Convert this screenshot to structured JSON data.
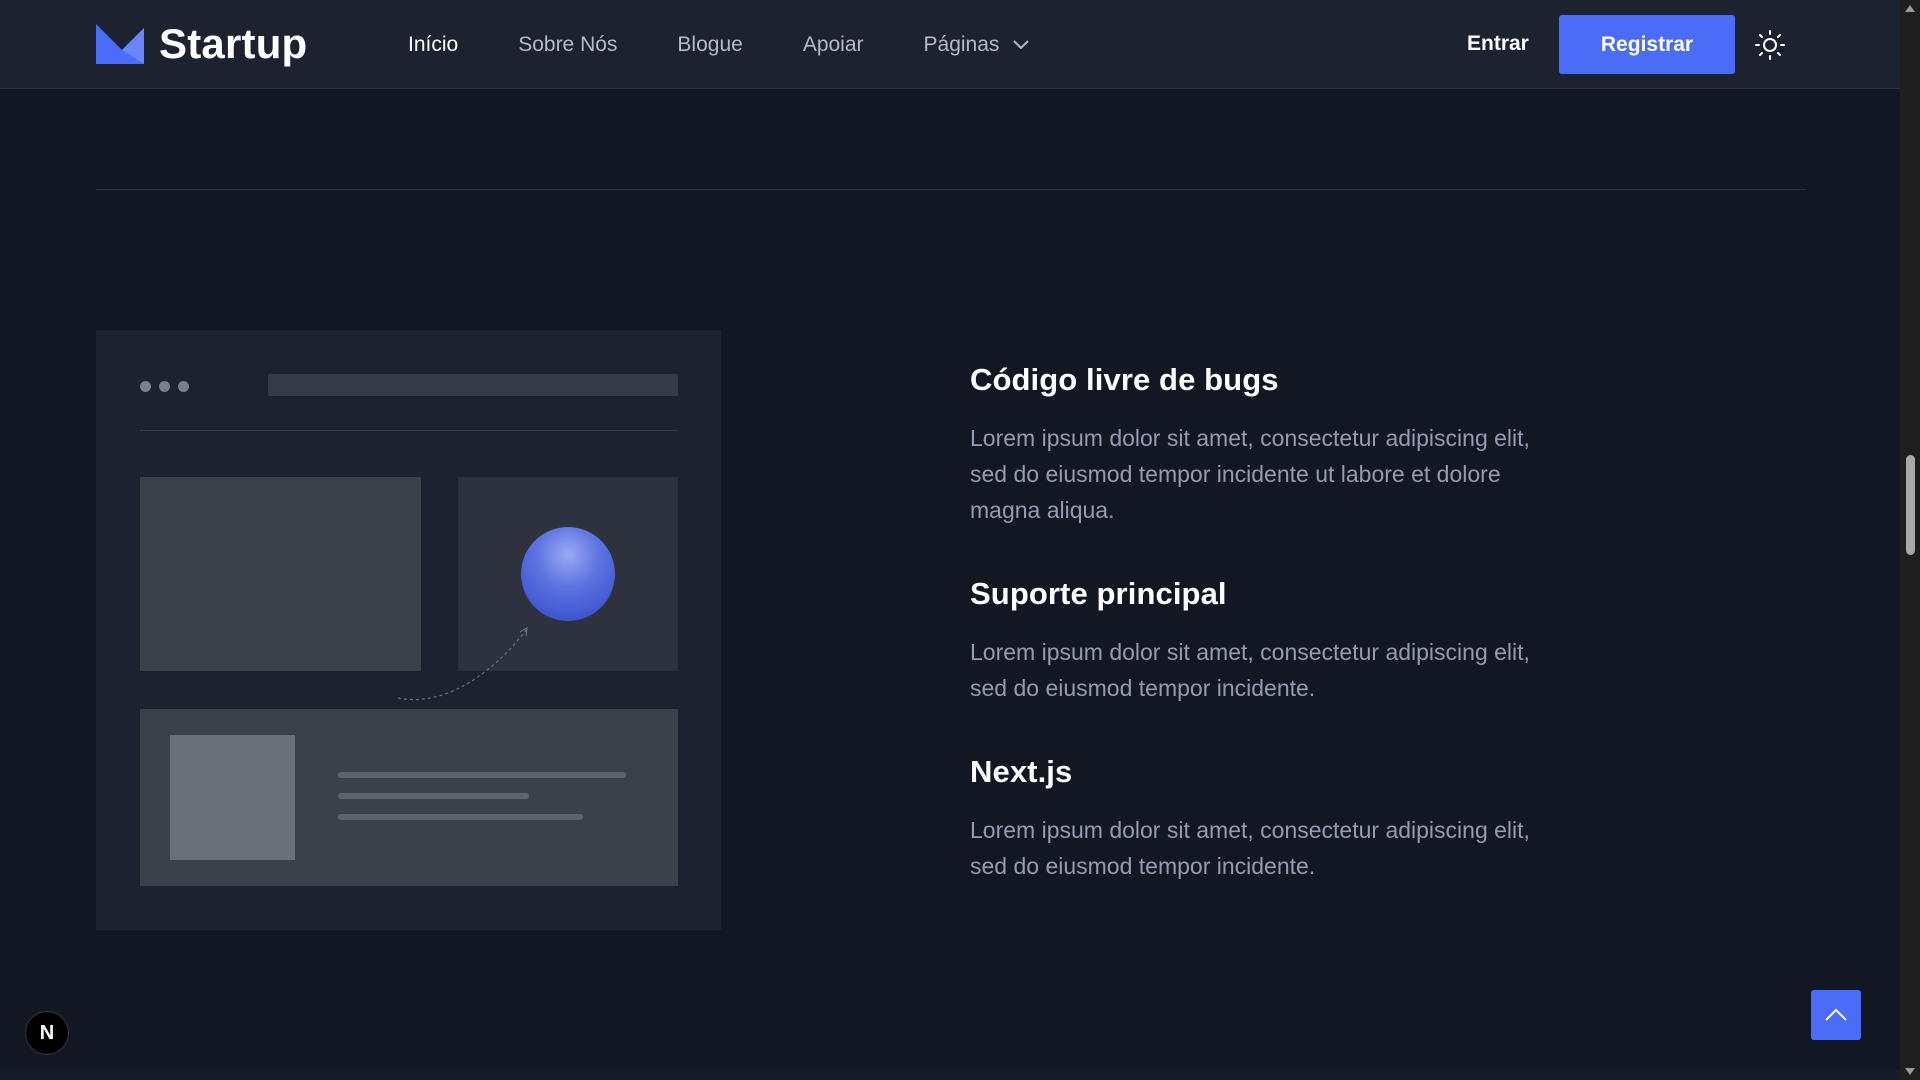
{
  "header": {
    "logo_text": "Startup",
    "nav": [
      {
        "label": "Início",
        "active": true
      },
      {
        "label": "Sobre Nós"
      },
      {
        "label": "Blogue"
      },
      {
        "label": "Apoiar"
      },
      {
        "label": "Páginas",
        "has_dropdown": true
      }
    ],
    "signin_label": "Entrar",
    "signup_label": "Registrar",
    "theme_icon": "sun-icon"
  },
  "features": [
    {
      "title": "Código livre de bugs",
      "text": "Lorem ipsum dolor sit amet, consectetur adipiscing elit, sed do eiusmod tempor incidente ut labore et dolore magna aliqua."
    },
    {
      "title": "Suporte principal",
      "text": "Lorem ipsum dolor sit amet, consectetur adipiscing elit, sed do eiusmod tempor incidente."
    },
    {
      "title": "Next.js",
      "text": "Lorem ipsum dolor sit amet, consectetur adipiscing elit, sed do eiusmod tempor incidente."
    }
  ],
  "floating": {
    "next_badge": "N",
    "scroll_top_icon": "chevron-up-icon"
  },
  "colors": {
    "accent": "#4a6cf7",
    "background": "#121723",
    "header_bg": "#1d2230",
    "muted_text": "#959cb1"
  }
}
